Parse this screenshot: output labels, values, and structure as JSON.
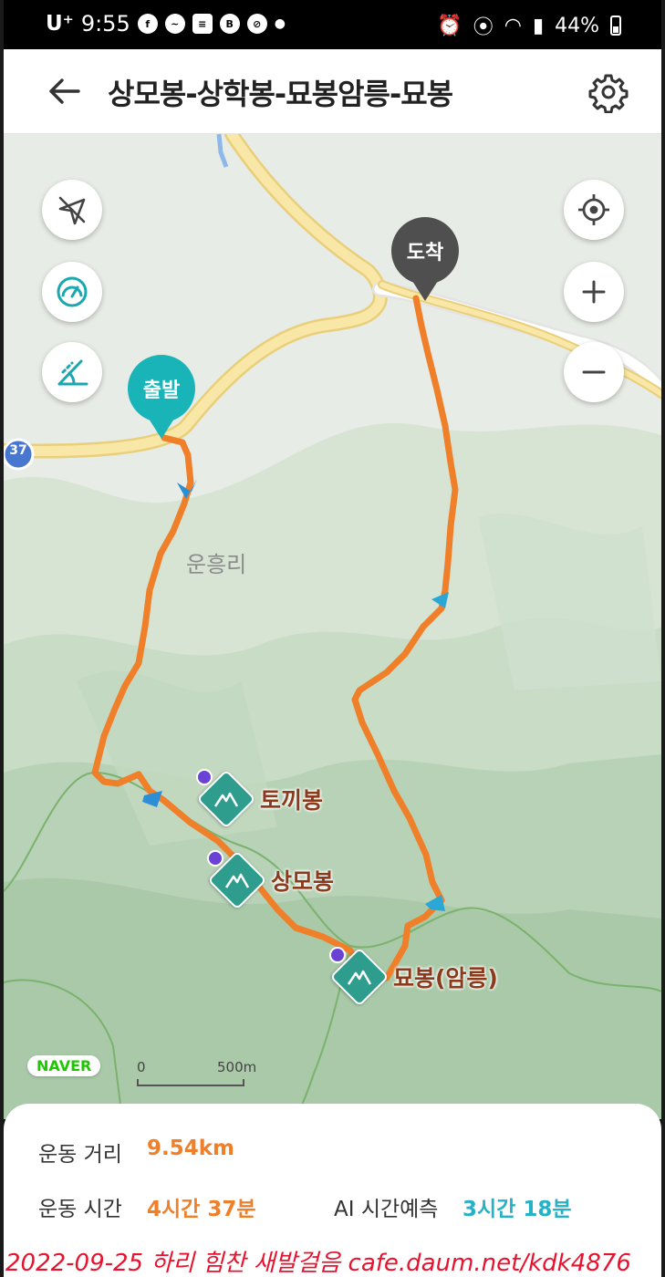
{
  "status_bar": {
    "carrier": "U⁺",
    "time": "9:55",
    "battery": "44%"
  },
  "header": {
    "title": "상모봉-상학봉-묘봉암릉-묘봉"
  },
  "map": {
    "road_shield": "37",
    "start_pin": "출발",
    "end_pin": "도착",
    "village": "운흥리",
    "peaks": [
      {
        "label": "토끼봉"
      },
      {
        "label": "상모봉"
      },
      {
        "label": "묘봉(암릉)"
      }
    ],
    "provider": "NAVER",
    "scale_start": "0",
    "scale_end": "500m"
  },
  "stats": {
    "distance_label": "운동 거리",
    "distance_value": "9.54km",
    "time_label": "운동 시간",
    "time_value": "4시간 37분",
    "ai_label": "AI 시간예측",
    "ai_value": "3시간 18분"
  },
  "watermark": "2022-09-25 하리 힘찬 새발걸음  cafe.daum.net/kdk4876",
  "colors": {
    "route": "#f07f2a",
    "start": "#19b4b8",
    "end": "#4f4f4f",
    "road": "#f6e3a0"
  }
}
